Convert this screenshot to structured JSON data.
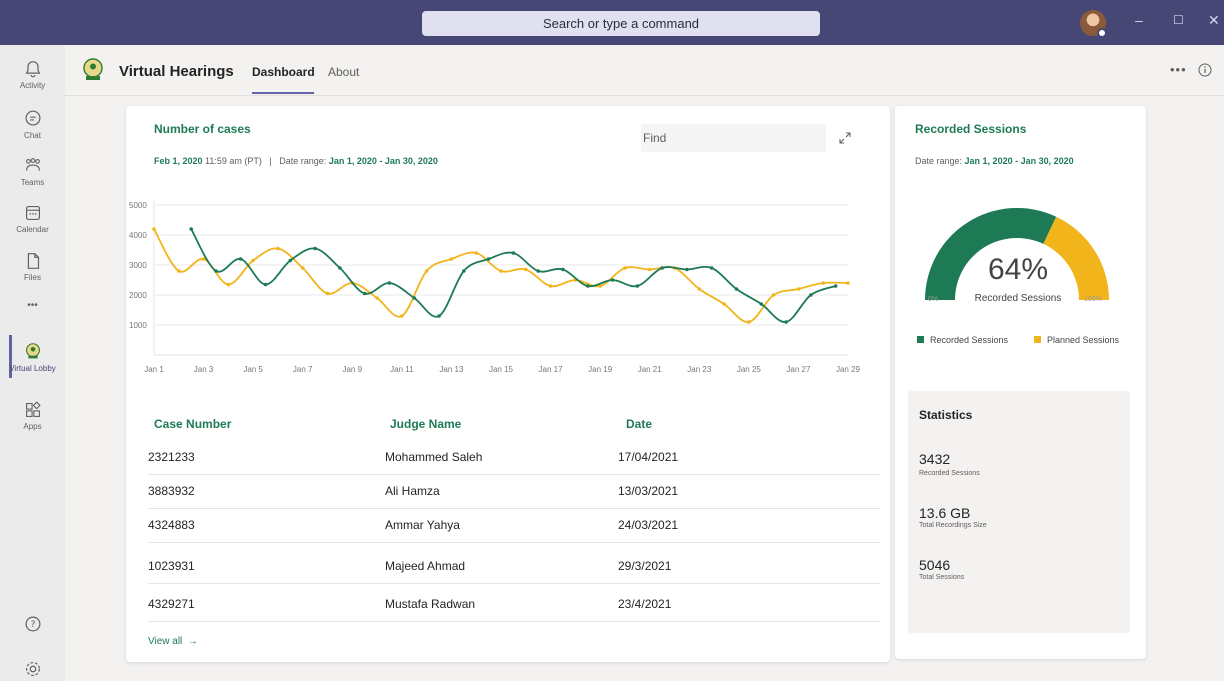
{
  "titlebar": {
    "search_placeholder": "Search or type a command",
    "minimize": "–",
    "maximize": "☐",
    "close": "✕"
  },
  "rail": {
    "items": [
      {
        "label": "Activity",
        "icon": "bell-icon"
      },
      {
        "label": "Chat",
        "icon": "chat-icon"
      },
      {
        "label": "Teams",
        "icon": "teams-icon"
      },
      {
        "label": "Calendar",
        "icon": "calendar-icon"
      },
      {
        "label": "Files",
        "icon": "file-icon"
      },
      {
        "label": "Virtual Lobby",
        "icon": "app-logo-icon"
      },
      {
        "label": "Apps",
        "icon": "apps-icon"
      }
    ],
    "more": "•••",
    "help": "?"
  },
  "header": {
    "app_title": "Virtual Hearings",
    "tabs": [
      {
        "label": "Dashboard",
        "active": true
      },
      {
        "label": "About",
        "active": false
      }
    ],
    "more": "•••"
  },
  "cases": {
    "title": "Number of cases",
    "date": "Feb 1, 2020",
    "time": "11:59 am (PT)",
    "separator": "|",
    "range_label": "Date range:",
    "range_value": "Jan 1, 2020 - Jan 30, 2020",
    "find_placeholder": "Find"
  },
  "chart_data": {
    "type": "line",
    "x_labels": [
      "Jan 1",
      "Jan 3",
      "Jan 5",
      "Jan 7",
      "Jan 9",
      "Jan 11",
      "Jan 13",
      "Jan 15",
      "Jan 17",
      "Jan 19",
      "Jan 21",
      "Jan 23",
      "Jan 25",
      "Jan 27",
      "Jan 29"
    ],
    "y_ticks": [
      1000,
      2000,
      3000,
      4000,
      5000
    ],
    "ylim": [
      0,
      5000
    ],
    "xlim": [
      1,
      29
    ],
    "grid": true,
    "series": [
      {
        "color": "#f2b41b",
        "x": [
          1,
          2,
          3,
          4,
          5,
          6,
          7,
          8,
          9,
          10,
          11,
          12,
          13,
          14,
          15,
          16,
          17,
          18,
          19,
          20,
          21,
          22,
          23,
          24,
          25,
          26,
          27,
          28,
          29
        ],
        "y": [
          4200,
          2800,
          3200,
          2350,
          3150,
          3550,
          2900,
          2050,
          2400,
          1900,
          1300,
          2800,
          3200,
          3400,
          2800,
          2850,
          2300,
          2500,
          2300,
          2900,
          2850,
          2900,
          2200,
          1700,
          1100,
          2000,
          2200,
          2400,
          2400
        ]
      },
      {
        "color": "#1d7a54",
        "x": [
          2.5,
          3.5,
          4.5,
          5.5,
          6.5,
          7.5,
          8.5,
          9.5,
          10.5,
          11.5,
          12.5,
          13.5,
          14.5,
          15.5,
          16.5,
          17.5,
          18.5,
          19.5,
          20.5,
          21.5,
          22.5,
          23.5,
          24.5,
          25.5,
          26.5,
          27.5,
          28.5
        ],
        "y": [
          4200,
          2800,
          3200,
          2350,
          3150,
          3550,
          2900,
          2050,
          2400,
          1900,
          1300,
          2800,
          3200,
          3400,
          2800,
          2850,
          2300,
          2500,
          2300,
          2900,
          2850,
          2900,
          2200,
          1700,
          1100,
          2000,
          2300
        ]
      }
    ]
  },
  "table": {
    "headers": [
      "Case Number",
      "Judge Name",
      "Date"
    ],
    "rows": [
      [
        "2321233",
        "Mohammed Saleh",
        "17/04/2021"
      ],
      [
        "3883932",
        "Ali Hamza",
        "13/03/2021"
      ],
      [
        "4324883",
        "Ammar Yahya",
        "24/03/2021"
      ],
      [
        "1023931",
        "Majeed Ahmad",
        "29/3/2021"
      ],
      [
        "4329271",
        "Mustafa Radwan",
        "23/4/2021"
      ]
    ],
    "view_all": "View all",
    "view_all_arrow": "→"
  },
  "recorded": {
    "title": "Recorded Sessions",
    "range_label": "Date range:",
    "range_value": "Jan 1, 2020 - Jan 30, 2020",
    "gauge_percent": 64,
    "gauge_text": "64%",
    "gauge_label": "Recorded Sessions",
    "gauge_min": "0%",
    "gauge_max": "100%",
    "legend": [
      {
        "label": "Recorded Sessions",
        "color": "#1d7a54"
      },
      {
        "label": "Planned Sessions",
        "color": "#f2b41b"
      }
    ]
  },
  "statistics": {
    "title": "Statistics",
    "items": [
      {
        "value": "3432",
        "label": "Recorded Sessions"
      },
      {
        "value": "13.6 GB",
        "label": "Total Recordings Size"
      },
      {
        "value": "5046",
        "label": "Total Sessions"
      }
    ]
  },
  "colors": {
    "teams_purple": "#464775",
    "accent_green": "#1d7a54",
    "accent_yellow": "#f2b41b"
  }
}
